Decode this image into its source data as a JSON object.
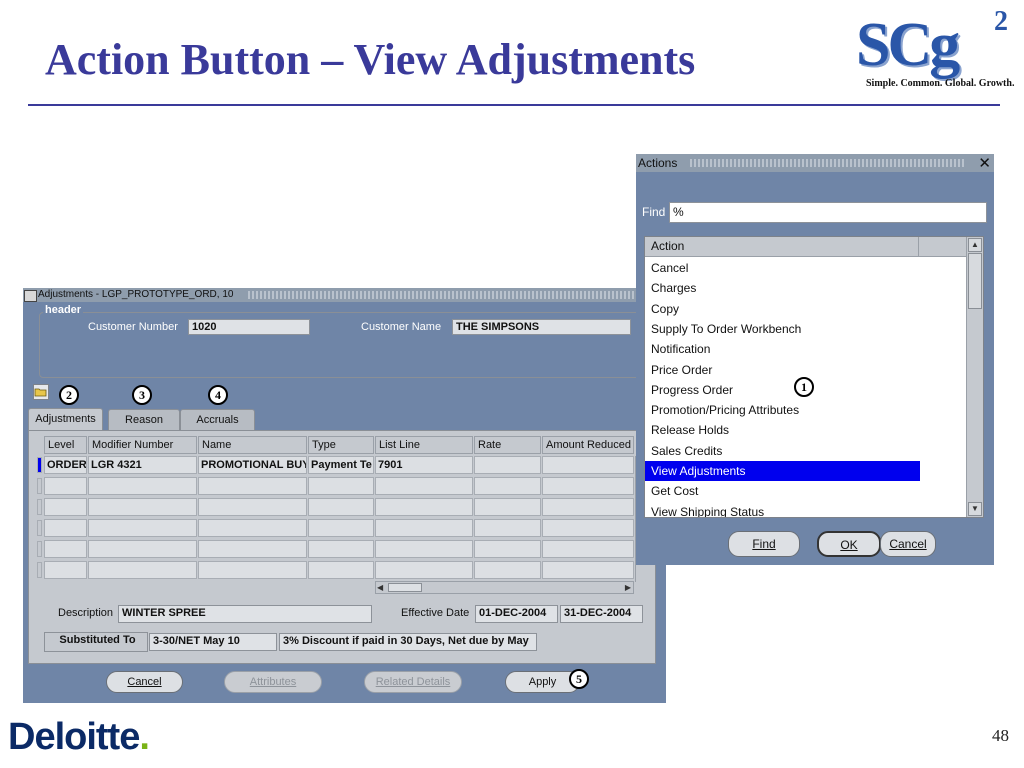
{
  "slide": {
    "title": "Action Button – View Adjustments",
    "page_number": "48",
    "logo_letters": "SCg",
    "logo_sup": "2",
    "logo_tagline": "Simple. Common. Global. Growth.",
    "footer_brand": "Deloitte",
    "footer_brand_dot": "."
  },
  "colors": {
    "title": "#3a3a9a",
    "window_bg": "#6f85a7",
    "panel": "#c5c9cf",
    "selection": "#0000ee"
  },
  "adjustments_window": {
    "title": "Adjustments - LGP_PROTOTYPE_ORD, 10",
    "group_label": "header",
    "customer_number_label": "Customer Number",
    "customer_number": "1020",
    "customer_name_label": "Customer Name",
    "customer_name": "THE SIMPSONS",
    "folder_icon": "folder-open-icon",
    "tabs": [
      "Adjustments",
      "Reason",
      "Accruals"
    ],
    "columns": [
      "Level",
      "Modifier Number",
      "Name",
      "Type",
      "List Line",
      "Rate",
      "Amount Reduced"
    ],
    "rows": [
      [
        "ORDER",
        "LGR 4321",
        "PROMOTIONAL BUY",
        "Payment Te",
        "7901",
        "",
        ""
      ],
      [
        "",
        "",
        "",
        "",
        "",
        "",
        ""
      ],
      [
        "",
        "",
        "",
        "",
        "",
        "",
        ""
      ],
      [
        "",
        "",
        "",
        "",
        "",
        "",
        ""
      ],
      [
        "",
        "",
        "",
        "",
        "",
        "",
        ""
      ],
      [
        "",
        "",
        "",
        "",
        "",
        "",
        ""
      ]
    ],
    "description_label": "Description",
    "description": "WINTER SPREE",
    "effective_date_label": "Effective Date",
    "effective_from": "01-DEC-2004",
    "effective_to": "31-DEC-2004",
    "substituted_to_label": "Substituted To",
    "substituted_to_value": "3-30/NET May 10",
    "substituted_to_desc": "3% Discount if paid in 30 Days, Net due by May",
    "buttons": {
      "cancel": "Cancel",
      "attributes": "Attributes",
      "related_details": "Related Details",
      "apply": "Apply"
    }
  },
  "actions_dialog": {
    "title": "Actions",
    "find_label": "Find",
    "find_value": "%",
    "column_header": "Action",
    "items": [
      "Cancel",
      "Charges",
      "Copy",
      "Supply To Order Workbench",
      "Notification",
      "Price Order",
      "Progress Order",
      "Promotion/Pricing Attributes",
      "Release Holds",
      "Sales Credits",
      "View Adjustments",
      "Get Cost",
      "View Shipping Status"
    ],
    "selected_item": "View Adjustments",
    "buttons": {
      "find": "Find",
      "ok": "OK",
      "cancel": "Cancel"
    }
  },
  "callouts": [
    "1",
    "2",
    "3",
    "4",
    "5"
  ]
}
